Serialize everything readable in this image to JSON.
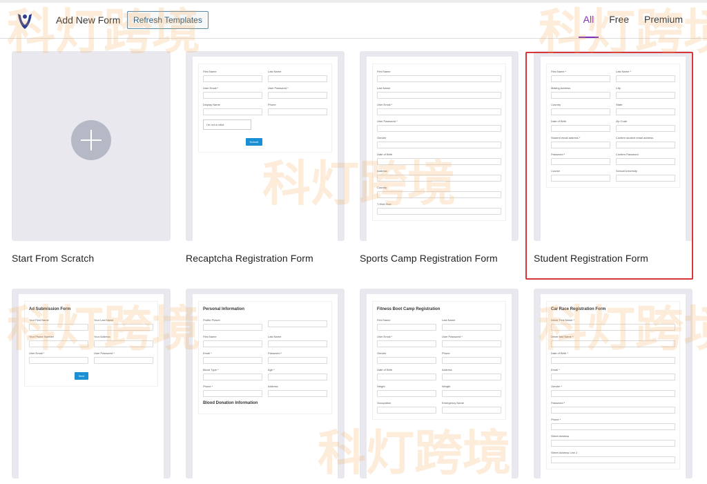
{
  "header": {
    "add_new": "Add New Form",
    "refresh": "Refresh Templates",
    "tabs": [
      "All",
      "Free",
      "Premium"
    ],
    "active_tab": "All"
  },
  "watermark": "科灯跨境",
  "cards": [
    {
      "title": "Start From Scratch",
      "type": "scratch"
    },
    {
      "title": "Recaptcha Registration Form",
      "heading": "",
      "fields": [
        "First Name",
        "Last Name",
        "User Email *",
        "User Password *",
        "Display Name",
        "Phone"
      ],
      "button": "Submit",
      "captcha": "I'm not a robot"
    },
    {
      "title": "Sports Camp Registration Form",
      "heading": "",
      "full": true,
      "fields": [
        "First Name",
        "Last Name",
        "User Email *",
        "User Password *",
        "Gender",
        "Date of Birth",
        "Address",
        "Country",
        "T-Shirt Size"
      ]
    },
    {
      "title": "Student Registration Form",
      "selected": true,
      "heading": "",
      "fields": [
        "First Name *",
        "Last Name *",
        "Mailing Address",
        "City",
        "Country",
        "State",
        "Date of Birth",
        "Zip Code",
        "Student email address *",
        "Confirm student email address",
        "Password *",
        "Confirm Password",
        "Course",
        "School/University"
      ]
    },
    {
      "title": "",
      "heading": "Ad Submission Form",
      "fields": [
        "Your First Name",
        "Your Last Name",
        "Your Phone Number",
        "Your Address",
        "User Email *",
        "User Password *"
      ],
      "button": "Next"
    },
    {
      "title": "",
      "heading": "Personal Information",
      "fields": [
        "Profile Picture",
        "",
        "First Name",
        "Last Name",
        "Email *",
        "Password *",
        "Blood Type *",
        "Age *",
        "Phone *",
        "Address"
      ],
      "subheading": "Blood Donation Information"
    },
    {
      "title": "",
      "heading": "Fitness Boot Camp Registration",
      "fields": [
        "First Name",
        "Last Name",
        "User Email *",
        "User Password *",
        "Gender",
        "Phone",
        "Date of Birth",
        "Address",
        "Height",
        "Weight",
        "Occupation",
        "Emergency Name"
      ]
    },
    {
      "title": "",
      "heading": "Car Race Registration Form",
      "full": true,
      "fields": [
        "Driver First Name *",
        "Driver last Name *",
        "Date of Birth *",
        "Email *",
        "Gender *",
        "Password *",
        "Phone *",
        "Street Address",
        "Street Address Line 2"
      ]
    }
  ]
}
